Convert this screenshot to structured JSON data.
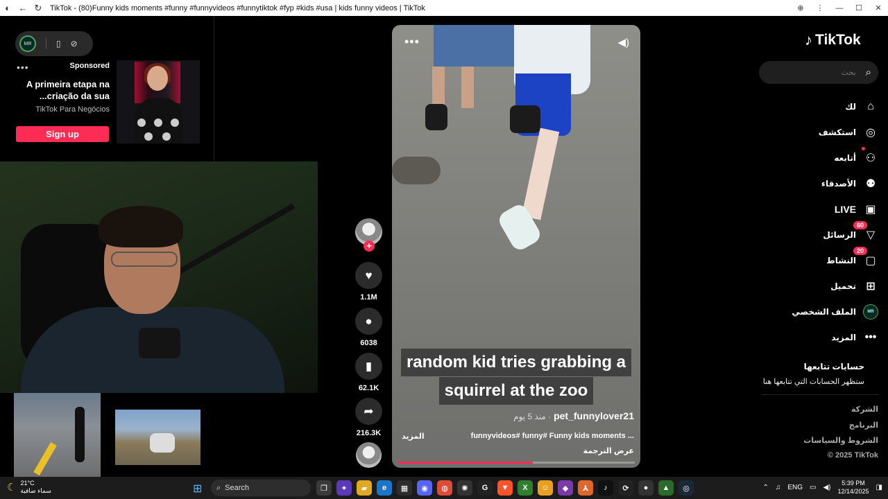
{
  "window": {
    "title": "TikTok - (80)Funny kids moments #funny #funnyvideos #funnytiktok #fyp #kids #usa | kids funny videos | TikTok"
  },
  "widget": {
    "avatar": "MR"
  },
  "ad": {
    "sponsored": "Sponsored",
    "headline_1": "A primeira etapa na",
    "headline_2": "...criação da sua",
    "source": "TikTok Para Negócios",
    "cta": "Sign up"
  },
  "video": {
    "caption_1": "random kid tries grabbing a",
    "caption_2": "squirrel at the zoo",
    "username": "pet_funnylover21",
    "time": "منذ 5 يوم ·",
    "description": "funnyvideos# funny# Funny kids moments ...",
    "more": "المزيد",
    "translate": "عرض الترجمة",
    "progress": 0.57
  },
  "actions": {
    "likes": "1.1M",
    "comments": "6038",
    "saves": "62.1K",
    "shares": "216.3K"
  },
  "brand": {
    "name": "TikTok",
    "accent": "#fe2c55"
  },
  "search": {
    "placeholder": "بحث"
  },
  "nav": {
    "for_you": "لك",
    "explore": "استكشف",
    "following": "أتابعه",
    "friends": "الأصدقاء",
    "live": "LIVE",
    "messages": "الرسائل",
    "messages_badge": "60",
    "activity": "النشاط",
    "activity_badge": "20",
    "upload": "تحميل",
    "profile": "الملف الشخصي",
    "more": "المزيد"
  },
  "following_section": {
    "title": "حسابات تتابعها",
    "subtitle": "ستظهر الحسابات التي تتابعها هنا"
  },
  "footer": {
    "company": "الشركة",
    "program": "البرنامج",
    "terms": "الشروط والسياسات",
    "copyright": "© 2025 TikTok"
  },
  "taskbar": {
    "weather_temp": "21°C",
    "weather_desc": "سماء صافية",
    "search": "Search",
    "lang": "ENG",
    "time": "5:39 PM",
    "date": "12/14/2025"
  }
}
